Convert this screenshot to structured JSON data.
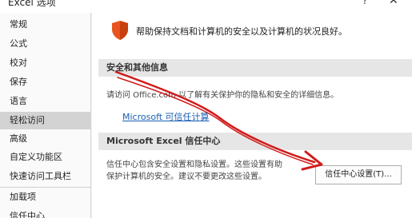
{
  "window": {
    "title": "Excel 选项",
    "help_glyph": "?",
    "close_glyph": "✕"
  },
  "sidebar": {
    "items": [
      {
        "label": "常规"
      },
      {
        "label": "公式"
      },
      {
        "label": "校对"
      },
      {
        "label": "保存"
      },
      {
        "label": "语言"
      },
      {
        "label": "轻松访问"
      },
      {
        "label": "高级"
      },
      {
        "label": "自定义功能区"
      },
      {
        "label": "快速访问工具栏"
      },
      {
        "label": "加载项"
      },
      {
        "label": "信任中心"
      }
    ],
    "selected": "轻松访问"
  },
  "main": {
    "intro_text": "帮助保持文档和计算机的安全以及计算机的状况良好。",
    "security_section": {
      "header": "安全和其他信息",
      "description": "请访问 Office.com 以了解有关保护你的隐私和安全的详细信息。",
      "link": "Microsoft 可信任计算"
    },
    "trust_section": {
      "header": "Microsoft Excel 信任中心",
      "description_line1": "信任中心包含安全设置和隐私设置。这些设置有助",
      "description_line2": "保护计算机的安全。建议不要更改这些设置。",
      "button_label": "信任中心设置(T)..."
    }
  },
  "colors": {
    "shield": "#e8541e",
    "link": "#1a5fb4",
    "arrow": "#d11a1a",
    "selected_nav": "#d3d3d3",
    "section_header": "#e6e6e6"
  },
  "icons": {
    "shield": "shield-icon",
    "arrow": "red-arrow-annotation"
  }
}
